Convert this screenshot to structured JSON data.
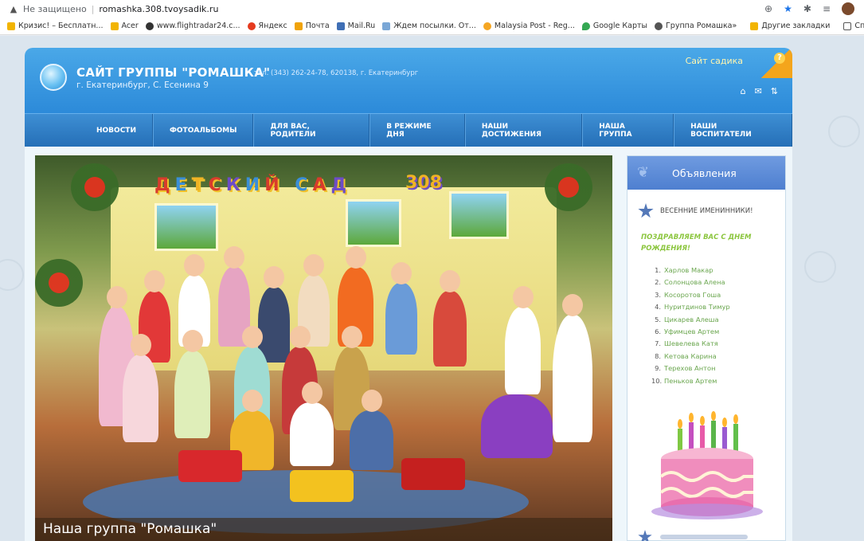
{
  "browser": {
    "not_secure_label": "Не защищено",
    "url": "romashka.308.tvoysadik.ru",
    "bookmarks": [
      {
        "label": "Кризис! – Бесплатн...",
        "color": "#f2b400"
      },
      {
        "label": "Acer",
        "color": "#f2b400"
      },
      {
        "label": "www.flightradar24.c...",
        "color": "#333333"
      },
      {
        "label": "Яндекс",
        "color": "#e53a1e"
      },
      {
        "label": "Почта",
        "color": "#f0a30a"
      },
      {
        "label": "Mail.Ru",
        "color": "#3f6fb5"
      },
      {
        "label": "Ждем посылки. От...",
        "color": "#7aa7d6"
      },
      {
        "label": "Malaysia Post - Reg...",
        "color": "#f5a623"
      },
      {
        "label": "Google Карты",
        "color": "#34a853"
      },
      {
        "label": "Группа Ромашка",
        "color": "#555555"
      }
    ],
    "bookmarks_more": "»",
    "other_bookmarks": "Другие закладки",
    "reading_list": "Список для чтен"
  },
  "site": {
    "title": "САЙТ ГРУППЫ \"РОМАШКА\"",
    "subtitle": "г. Екатеринбург, С. Есенина 9",
    "contacts": "тел. (343) 262-24-78, 620138, г. Екатеринбург",
    "kindergarten_link": "Сайт садика",
    "nav": [
      "НОВОСТИ",
      "ФОТОАЛЬБОМЫ",
      "ДЛЯ ВАС, РОДИТЕЛИ",
      "В РЕЖИМЕ ДНЯ",
      "НАШИ ДОСТИЖЕНИЯ",
      "НАША ГРУППА",
      "НАШИ ВОСПИТАТЕЛИ"
    ],
    "photo_sign": "ДЕТСКИЙ САД",
    "photo_number": "308",
    "photo_caption": "Наша группа \"Ромашка\""
  },
  "sidebar": {
    "title": "Объявления",
    "item_title": "ВЕСЕННИЕ ИМЕНИННИКИ!",
    "greeting": "ПОЗДРАВЛЯЕМ ВАС С ДНЕМ РОЖДЕНИЯ!",
    "names": [
      "Харлов Макар",
      "Солонцова Алена",
      "Косоротов Гоша",
      "Нуритдинов Тимур",
      "Цикарев Алеша",
      "Уфимцев Артем",
      "Шевелева Катя",
      "Кетова Карина",
      "Терехов Антон",
      "Пеньков Артем"
    ]
  }
}
